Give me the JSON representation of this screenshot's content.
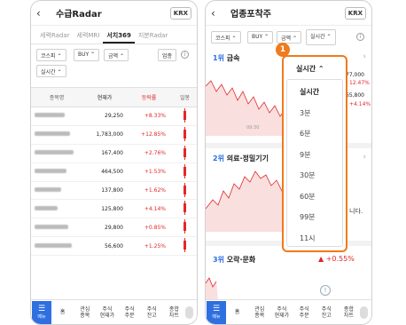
{
  "left": {
    "title": "수급Radar",
    "krx": "KRX",
    "tabs": [
      "세력Radar",
      "세력MRI",
      "서치369",
      "지분Radar"
    ],
    "filters": {
      "market": "코스피",
      "type": "BUY",
      "amount": "금액",
      "sector": "업종",
      "period": "실시간"
    },
    "columns": {
      "name": "종목명",
      "price": "현재가",
      "rate": "등락률",
      "daily": "일봉"
    },
    "rows": [
      {
        "price": "29,250",
        "rate": "+8.33%"
      },
      {
        "price": "1,783,000",
        "rate": "+12.85%"
      },
      {
        "price": "167,400",
        "rate": "+2.76%"
      },
      {
        "price": "464,500",
        "rate": "+1.53%"
      },
      {
        "price": "137,800",
        "rate": "+1.62%"
      },
      {
        "price": "125,800",
        "rate": "+4.14%"
      },
      {
        "price": "29,800",
        "rate": "+0.85%"
      },
      {
        "price": "56,600",
        "rate": "+1.25%"
      }
    ]
  },
  "right": {
    "title": "업종포착주",
    "krx": "KRX",
    "filters": {
      "market": "코스피",
      "type": "BUY",
      "amount": "금액",
      "period": "실시간"
    },
    "sections": [
      {
        "rank": "1위",
        "name": "금속"
      },
      {
        "rank": "2위",
        "name": "의료·정밀기기"
      },
      {
        "rank": "3위",
        "name": "오락·문화"
      }
    ],
    "peek": {
      "val1": "77,000",
      "pct1": "12.47%",
      "val2": "65,800",
      "pct2": "+4.14%",
      "time": "09:30",
      "text": "니다.",
      "pct3": "+0.55%"
    },
    "badge": "1",
    "dropdown": {
      "header": "실시간",
      "items": [
        "실시간",
        "3분",
        "6분",
        "9분",
        "30분",
        "60분",
        "99분",
        "11시"
      ]
    }
  },
  "nav": {
    "menu": "메뉴",
    "items": [
      "홈",
      "관심\n종목",
      "주식\n현재가",
      "주식\n주문",
      "주식\n잔고",
      "종합\n차트"
    ]
  },
  "colors": {
    "up": "#e0282a",
    "accent": "#2f6fe0",
    "highlight": "#f07a1c"
  }
}
